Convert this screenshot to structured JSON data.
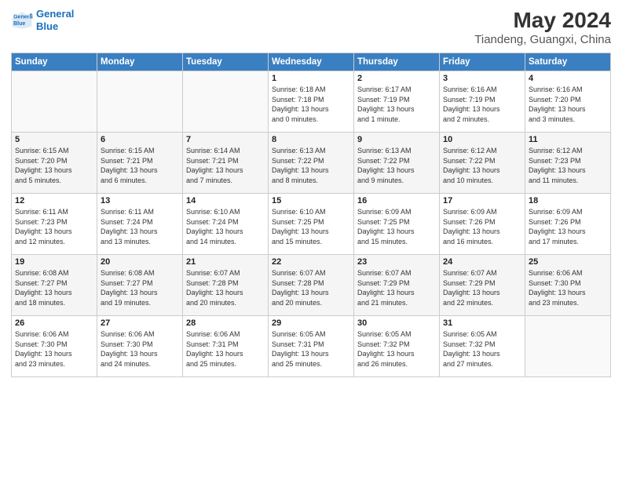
{
  "logo": {
    "line1": "General",
    "line2": "Blue"
  },
  "title": "May 2024",
  "location": "Tiandeng, Guangxi, China",
  "days_of_week": [
    "Sunday",
    "Monday",
    "Tuesday",
    "Wednesday",
    "Thursday",
    "Friday",
    "Saturday"
  ],
  "weeks": [
    [
      {
        "day": "",
        "detail": ""
      },
      {
        "day": "",
        "detail": ""
      },
      {
        "day": "",
        "detail": ""
      },
      {
        "day": "1",
        "detail": "Sunrise: 6:18 AM\nSunset: 7:18 PM\nDaylight: 13 hours\nand 0 minutes."
      },
      {
        "day": "2",
        "detail": "Sunrise: 6:17 AM\nSunset: 7:19 PM\nDaylight: 13 hours\nand 1 minute."
      },
      {
        "day": "3",
        "detail": "Sunrise: 6:16 AM\nSunset: 7:19 PM\nDaylight: 13 hours\nand 2 minutes."
      },
      {
        "day": "4",
        "detail": "Sunrise: 6:16 AM\nSunset: 7:20 PM\nDaylight: 13 hours\nand 3 minutes."
      }
    ],
    [
      {
        "day": "5",
        "detail": "Sunrise: 6:15 AM\nSunset: 7:20 PM\nDaylight: 13 hours\nand 5 minutes."
      },
      {
        "day": "6",
        "detail": "Sunrise: 6:15 AM\nSunset: 7:21 PM\nDaylight: 13 hours\nand 6 minutes."
      },
      {
        "day": "7",
        "detail": "Sunrise: 6:14 AM\nSunset: 7:21 PM\nDaylight: 13 hours\nand 7 minutes."
      },
      {
        "day": "8",
        "detail": "Sunrise: 6:13 AM\nSunset: 7:22 PM\nDaylight: 13 hours\nand 8 minutes."
      },
      {
        "day": "9",
        "detail": "Sunrise: 6:13 AM\nSunset: 7:22 PM\nDaylight: 13 hours\nand 9 minutes."
      },
      {
        "day": "10",
        "detail": "Sunrise: 6:12 AM\nSunset: 7:22 PM\nDaylight: 13 hours\nand 10 minutes."
      },
      {
        "day": "11",
        "detail": "Sunrise: 6:12 AM\nSunset: 7:23 PM\nDaylight: 13 hours\nand 11 minutes."
      }
    ],
    [
      {
        "day": "12",
        "detail": "Sunrise: 6:11 AM\nSunset: 7:23 PM\nDaylight: 13 hours\nand 12 minutes."
      },
      {
        "day": "13",
        "detail": "Sunrise: 6:11 AM\nSunset: 7:24 PM\nDaylight: 13 hours\nand 13 minutes."
      },
      {
        "day": "14",
        "detail": "Sunrise: 6:10 AM\nSunset: 7:24 PM\nDaylight: 13 hours\nand 14 minutes."
      },
      {
        "day": "15",
        "detail": "Sunrise: 6:10 AM\nSunset: 7:25 PM\nDaylight: 13 hours\nand 15 minutes."
      },
      {
        "day": "16",
        "detail": "Sunrise: 6:09 AM\nSunset: 7:25 PM\nDaylight: 13 hours\nand 15 minutes."
      },
      {
        "day": "17",
        "detail": "Sunrise: 6:09 AM\nSunset: 7:26 PM\nDaylight: 13 hours\nand 16 minutes."
      },
      {
        "day": "18",
        "detail": "Sunrise: 6:09 AM\nSunset: 7:26 PM\nDaylight: 13 hours\nand 17 minutes."
      }
    ],
    [
      {
        "day": "19",
        "detail": "Sunrise: 6:08 AM\nSunset: 7:27 PM\nDaylight: 13 hours\nand 18 minutes."
      },
      {
        "day": "20",
        "detail": "Sunrise: 6:08 AM\nSunset: 7:27 PM\nDaylight: 13 hours\nand 19 minutes."
      },
      {
        "day": "21",
        "detail": "Sunrise: 6:07 AM\nSunset: 7:28 PM\nDaylight: 13 hours\nand 20 minutes."
      },
      {
        "day": "22",
        "detail": "Sunrise: 6:07 AM\nSunset: 7:28 PM\nDaylight: 13 hours\nand 20 minutes."
      },
      {
        "day": "23",
        "detail": "Sunrise: 6:07 AM\nSunset: 7:29 PM\nDaylight: 13 hours\nand 21 minutes."
      },
      {
        "day": "24",
        "detail": "Sunrise: 6:07 AM\nSunset: 7:29 PM\nDaylight: 13 hours\nand 22 minutes."
      },
      {
        "day": "25",
        "detail": "Sunrise: 6:06 AM\nSunset: 7:30 PM\nDaylight: 13 hours\nand 23 minutes."
      }
    ],
    [
      {
        "day": "26",
        "detail": "Sunrise: 6:06 AM\nSunset: 7:30 PM\nDaylight: 13 hours\nand 23 minutes."
      },
      {
        "day": "27",
        "detail": "Sunrise: 6:06 AM\nSunset: 7:30 PM\nDaylight: 13 hours\nand 24 minutes."
      },
      {
        "day": "28",
        "detail": "Sunrise: 6:06 AM\nSunset: 7:31 PM\nDaylight: 13 hours\nand 25 minutes."
      },
      {
        "day": "29",
        "detail": "Sunrise: 6:05 AM\nSunset: 7:31 PM\nDaylight: 13 hours\nand 25 minutes."
      },
      {
        "day": "30",
        "detail": "Sunrise: 6:05 AM\nSunset: 7:32 PM\nDaylight: 13 hours\nand 26 minutes."
      },
      {
        "day": "31",
        "detail": "Sunrise: 6:05 AM\nSunset: 7:32 PM\nDaylight: 13 hours\nand 27 minutes."
      },
      {
        "day": "",
        "detail": ""
      }
    ]
  ]
}
